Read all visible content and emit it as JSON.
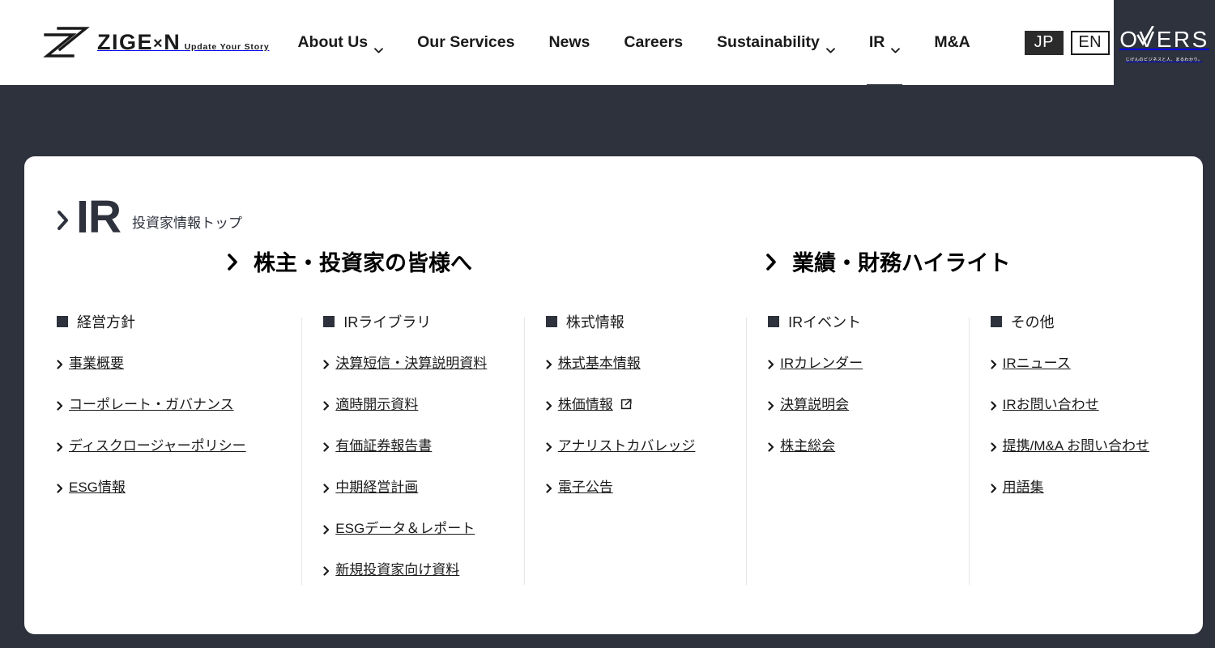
{
  "brand": {
    "name_prefix": "ZIGE",
    "name_x": "×",
    "name_suffix": "N",
    "tagline": "Update Your Story",
    "logo_icon": "zigexn-mark-icon"
  },
  "nav": {
    "items": [
      {
        "label": "About Us",
        "has_caret": true,
        "active": false
      },
      {
        "label": "Our Services",
        "has_caret": false,
        "active": false
      },
      {
        "label": "News",
        "has_caret": false,
        "active": false
      },
      {
        "label": "Careers",
        "has_caret": false,
        "active": false
      },
      {
        "label": "Sustainability",
        "has_caret": true,
        "active": false
      },
      {
        "label": "IR",
        "has_caret": true,
        "active": true
      },
      {
        "label": "M&A",
        "has_caret": false,
        "active": false
      }
    ]
  },
  "lang": {
    "jp": "JP",
    "en": "EN",
    "active": "JP"
  },
  "overs": {
    "word": "OVERS",
    "tagline": "じげんのビジネスと人、まるわかり。"
  },
  "page": {
    "title": "IR",
    "subtitle": "投資家情報トップ"
  },
  "sections": [
    {
      "label": "株主・投資家の皆様へ"
    },
    {
      "label": "業績・財務ハイライト"
    }
  ],
  "columns": [
    {
      "heading": "経営方針",
      "links": [
        {
          "label": "事業概要",
          "external": false
        },
        {
          "label": "コーポレート・ガバナンス",
          "external": false
        },
        {
          "label": "ディスクロージャーポリシー",
          "external": false
        },
        {
          "label": "ESG情報",
          "external": false
        }
      ]
    },
    {
      "heading": "IRライブラリ",
      "links": [
        {
          "label": "決算短信・決算説明資料",
          "external": false
        },
        {
          "label": "適時開示資料",
          "external": false
        },
        {
          "label": "有価証券報告書",
          "external": false
        },
        {
          "label": "中期経営計画",
          "external": false
        },
        {
          "label": "ESGデータ＆レポート",
          "external": false
        },
        {
          "label": "新規投資家向け資料",
          "external": false
        }
      ]
    },
    {
      "heading": "株式情報",
      "links": [
        {
          "label": "株式基本情報",
          "external": false
        },
        {
          "label": "株価情報",
          "external": true
        },
        {
          "label": "アナリストカバレッジ",
          "external": false
        },
        {
          "label": "電子公告",
          "external": false
        }
      ]
    },
    {
      "heading": "IRイベント",
      "links": [
        {
          "label": "IRカレンダー",
          "external": false
        },
        {
          "label": "決算説明会",
          "external": false
        },
        {
          "label": "株主総会",
          "external": false
        }
      ]
    },
    {
      "heading": "その他",
      "links": [
        {
          "label": "IRニュース",
          "external": false
        },
        {
          "label": "IRお問い合わせ",
          "external": false
        },
        {
          "label": "提携/M&A お問い合わせ",
          "external": false
        },
        {
          "label": "用語集",
          "external": false
        }
      ]
    }
  ],
  "colors": {
    "page_background": "#2e323c",
    "card_background": "#ffffff",
    "header_background": "#ffffff",
    "text": "#1a1a1a",
    "accent_dark": "#2e323c",
    "divider": "#e6e6e6"
  }
}
